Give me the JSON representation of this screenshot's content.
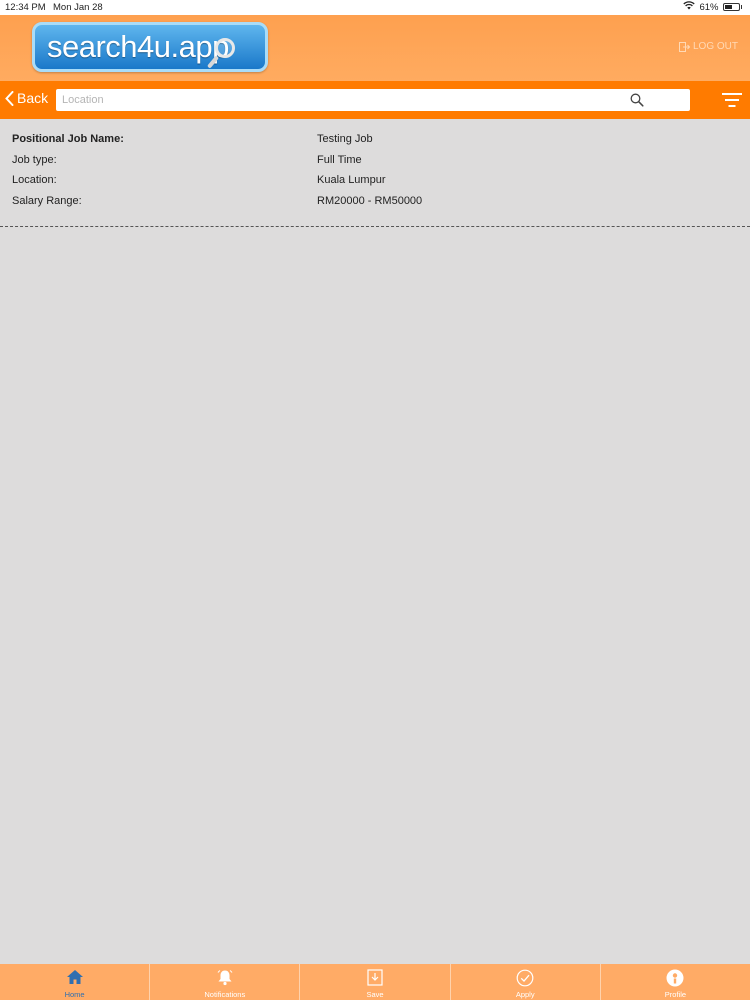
{
  "status_bar": {
    "time": "12:34 PM",
    "date": "Mon Jan 28",
    "battery": "61%",
    "battery_level": 0.61
  },
  "header": {
    "logo_text": "search4u.app",
    "logout_label": "LOG OUT"
  },
  "search_bar": {
    "back_label": "Back",
    "placeholder": "Location",
    "value": ""
  },
  "job": {
    "rows": [
      {
        "label": "Positional Job Name:",
        "value": "Testing Job"
      },
      {
        "label": "Job type:",
        "value": "Full Time"
      },
      {
        "label": "Location:",
        "value": "Kuala Lumpur"
      },
      {
        "label": "Salary Range:",
        "value": "RM20000 - RM50000"
      }
    ]
  },
  "tabs": [
    {
      "label": "Home",
      "icon": "home-icon",
      "active": true
    },
    {
      "label": "Notifications",
      "icon": "bell-icon",
      "active": false
    },
    {
      "label": "Save",
      "icon": "save-icon",
      "active": false
    },
    {
      "label": "Apply",
      "icon": "check-circle-icon",
      "active": false
    },
    {
      "label": "Profile",
      "icon": "profile-icon",
      "active": false
    }
  ],
  "colors": {
    "header": "#FFA55A",
    "toolbar": "#FF7B00",
    "tab_bar": "#FFAB66",
    "active_tab": "#2F6FB0",
    "background": "#DDDCDC"
  }
}
